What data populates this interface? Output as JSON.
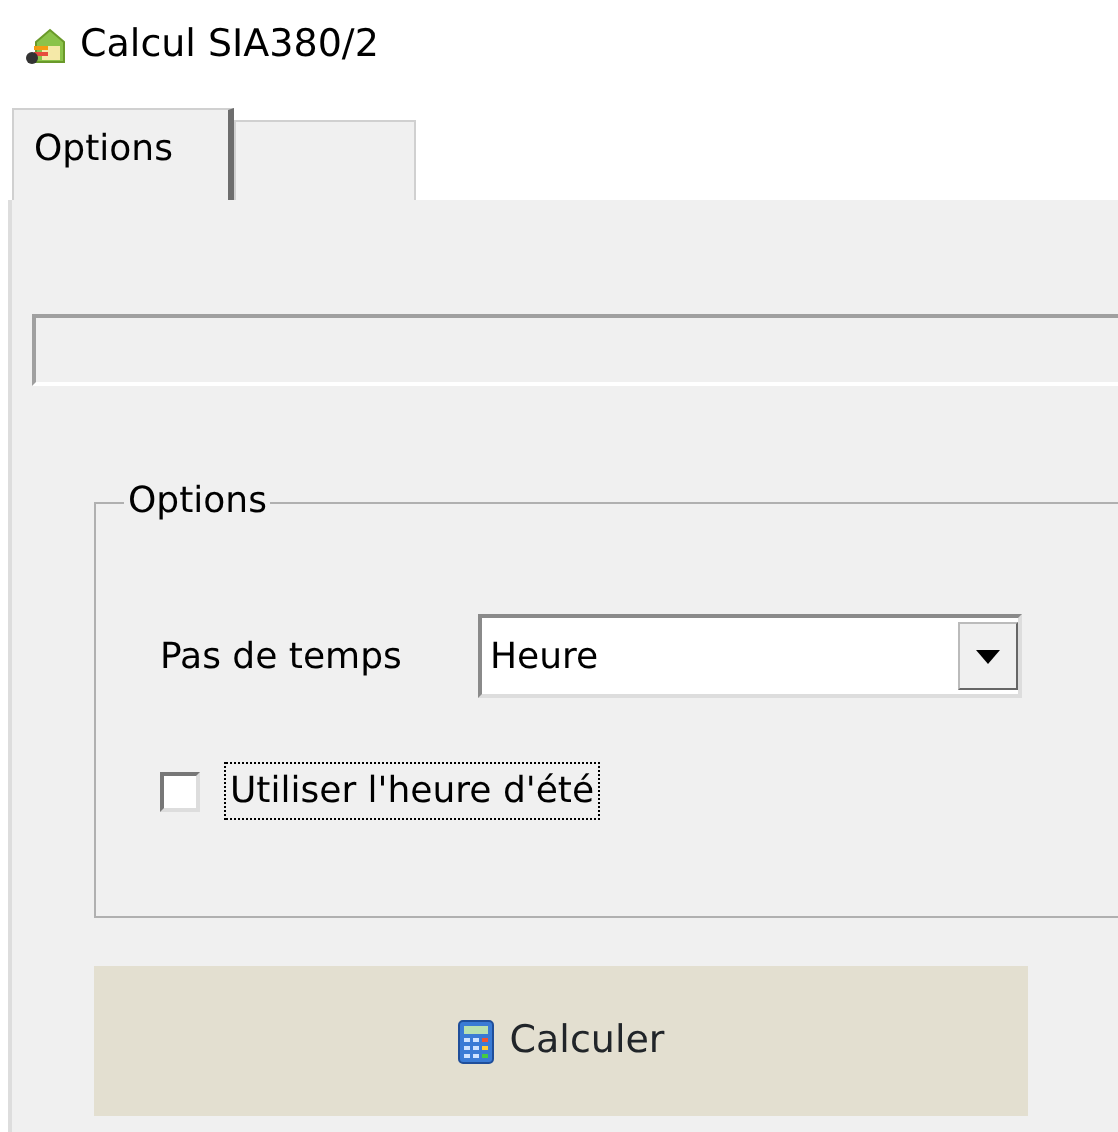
{
  "window": {
    "title": "Calcul SIA380/2"
  },
  "tabs": [
    {
      "label": "Options",
      "selected": true
    },
    {
      "selected": false
    }
  ],
  "group": {
    "title": "Options",
    "time_step": {
      "label": "Pas de temps",
      "value": "Heure"
    },
    "summer_time": {
      "label": "Utiliser l'heure d'été",
      "checked": false,
      "focused": true
    }
  },
  "buttons": [
    {
      "label": "Calculer"
    }
  ]
}
